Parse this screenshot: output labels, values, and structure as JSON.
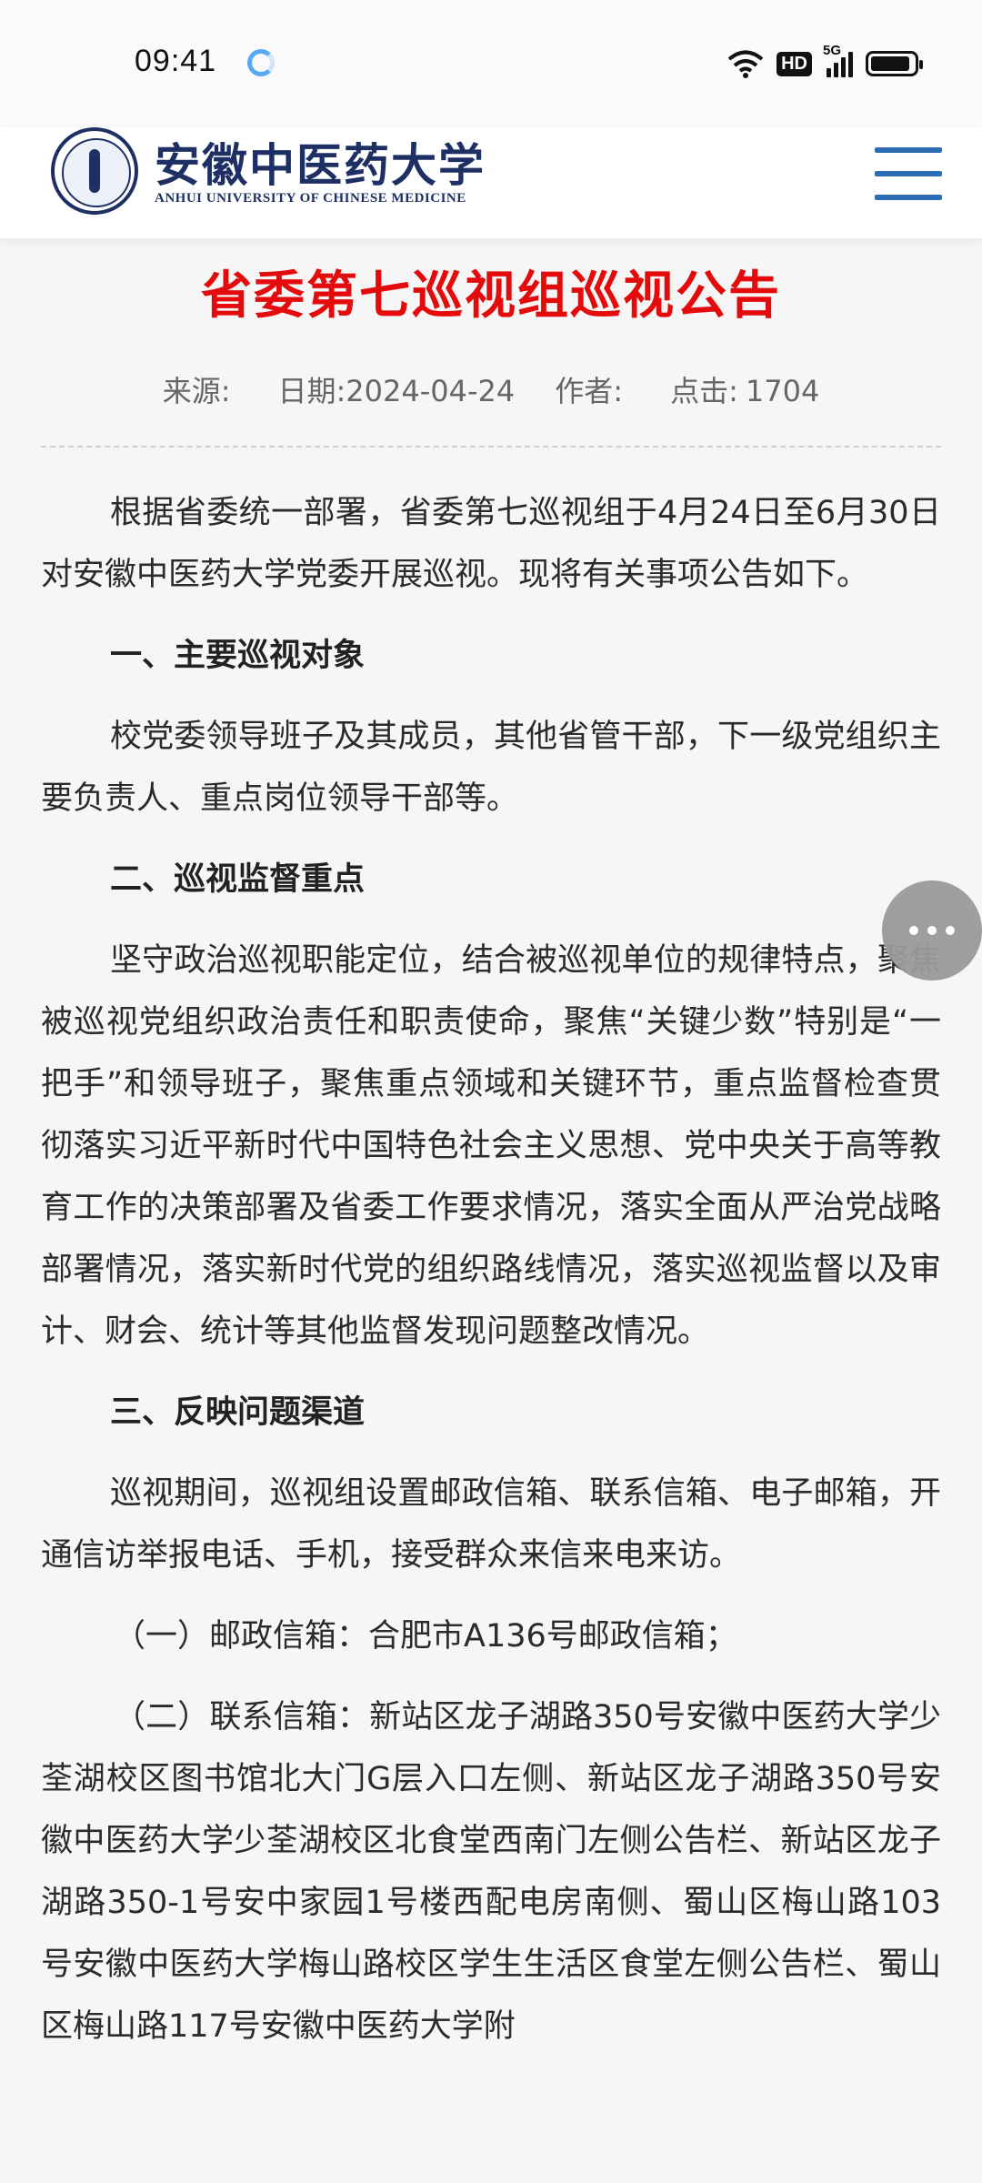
{
  "status_bar": {
    "time": "09:41",
    "hd": "HD",
    "network": "5G"
  },
  "header": {
    "logo_cn": "安徽中医药大学",
    "logo_en": "ANHUI UNIVERSITY OF CHINESE MEDICINE"
  },
  "article": {
    "title": "省委第七巡视组巡视公告",
    "meta": {
      "source_label": "来源:",
      "source_value": "",
      "date_label": "日期:",
      "date_value": "2024-04-24",
      "author_label": "作者:",
      "author_value": "",
      "clicks_label": "点击:",
      "clicks_value": "1704"
    },
    "para1": "根据省委统一部署，省委第七巡视组于4月24日至6月30日对安徽中医药大学党委开展巡视。现将有关事项公告如下。",
    "h1": "一、主要巡视对象",
    "para2": "校党委领导班子及其成员，其他省管干部，下一级党组织主要负责人、重点岗位领导干部等。",
    "h2": "二、巡视监督重点",
    "para3": "坚守政治巡视职能定位，结合被巡视单位的规律特点，聚焦被巡视党组织政治责任和职责使命，聚焦“关键少数”特别是“一把手”和领导班子，聚焦重点领域和关键环节，重点监督检查贯彻落实习近平新时代中国特色社会主义思想、党中央关于高等教育工作的决策部署及省委工作要求情况，落实全面从严治党战略部署情况，落实新时代党的组织路线情况，落实巡视监督以及审计、财会、统计等其他监督发现问题整改情况。",
    "h3": "三、反映问题渠道",
    "para4": "巡视期间，巡视组设置邮政信箱、联系信箱、电子邮箱，开通信访举报电话、手机，接受群众来信来电来访。",
    "para5": "（一）邮政信箱：合肥市A136号邮政信箱；",
    "para6": "（二）联系信箱：新站区龙子湖路350号安徽中医药大学少荃湖校区图书馆北大门G层入口左侧、新站区龙子湖路350号安徽中医药大学少荃湖校区北食堂西南门左侧公告栏、新站区龙子湖路350-1号安中家园1号楼西配电房南侧、蜀山区梅山路103号安徽中医药大学梅山路校区学生生活区食堂左侧公告栏、蜀山区梅山路117号安徽中医药大学附"
  }
}
